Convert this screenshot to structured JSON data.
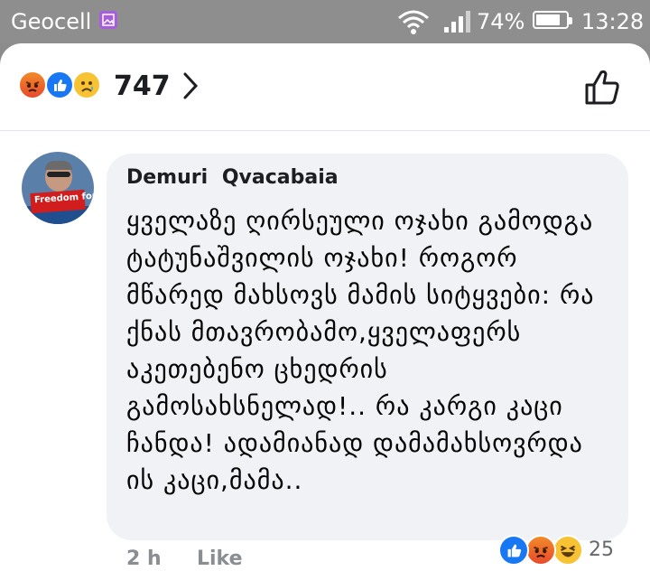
{
  "status_bar": {
    "carrier": "Geocell",
    "battery": "74%",
    "time": "13:28"
  },
  "reactions_header": {
    "reaction_icons": [
      "angry-icon",
      "like-icon",
      "sad-icon"
    ],
    "count": "747"
  },
  "comment": {
    "author": "Demuri  Qvacabaia",
    "avatar_banner": "Freedom for",
    "body": "ყველაზე ღირსეული ოჯახი გამოდგა ტატუნაშვილის ოჯახი! როგორ მწარედ მახსოვს მამის სიტყვები: რა ქნას მთავრობამო,ყველაფერს აკეთებენო ცხედრის გამოსახსნელად!.. რა კარგი კაცი ჩანდა! ადამიანად დამამახსოვრდა ის კაცი,მამა..",
    "time": "2 h",
    "like_label": "Like",
    "reaction_icons": [
      "like-icon",
      "angry-icon",
      "haha-icon"
    ],
    "reaction_count": "25"
  },
  "colors": {
    "facebook_blue": "#1877f2",
    "bubble_bg": "#f0f2f5",
    "muted_text": "#8a8d91"
  }
}
